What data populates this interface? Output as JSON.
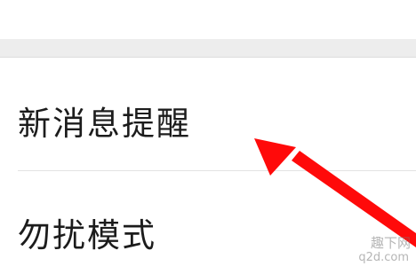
{
  "settings": {
    "items": [
      {
        "label": "新消息提醒"
      },
      {
        "label": "勿扰模式"
      }
    ]
  },
  "annotation": {
    "arrow_color": "#ff0a0a",
    "arrow_target": "settings.items.0"
  },
  "watermark": {
    "main": "趣下网",
    "sub": "q2d.com"
  },
  "colors": {
    "section_gap": "#ededed",
    "row_background": "#ffffff",
    "text": "#1c1c1c",
    "divider": "#e2e2e2"
  }
}
